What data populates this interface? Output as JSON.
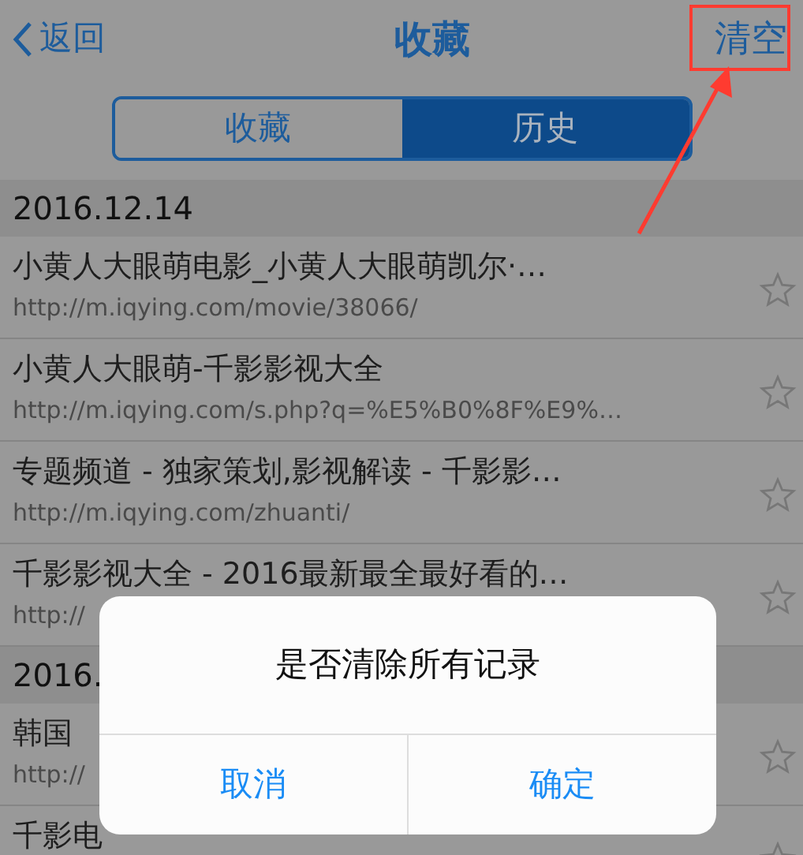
{
  "nav": {
    "back": "返回",
    "title": "收藏",
    "action": "清空"
  },
  "segments": [
    {
      "label": "收藏",
      "selected": false
    },
    {
      "label": "历史",
      "selected": true
    }
  ],
  "sections": [
    {
      "date": "2016.12.14",
      "items": [
        {
          "title": "小黄人大眼萌电影_小黄人大眼萌凯尔·…",
          "url": "http://m.iqying.com/movie/38066/"
        },
        {
          "title": "小黄人大眼萌-千影影视大全",
          "url": "http://m.iqying.com/s.php?q=%E5%B0%8F%E9%…"
        },
        {
          "title": "专题频道 - 独家策划,影视解读 - 千影影…",
          "url": "http://m.iqying.com/zhuanti/"
        },
        {
          "title": "千影影视大全 - 2016最新最全最好看的…",
          "url": "http://"
        }
      ]
    },
    {
      "date": "2016.",
      "items": [
        {
          "title": "韩国",
          "url": "http://"
        },
        {
          "title": "千影电"
        }
      ]
    }
  ],
  "dialog": {
    "message": "是否清除所有记录",
    "buttons": [
      "取消",
      "确定"
    ]
  }
}
